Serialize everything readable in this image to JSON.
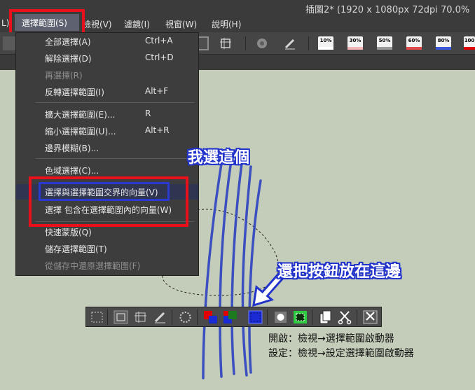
{
  "titlebar": {
    "title": "插圖2* (1920 x 1080px 72dpi 70.0%"
  },
  "menubar": {
    "items": [
      {
        "label": "L)"
      },
      {
        "label": "選擇範圍(S)"
      },
      {
        "label": "檢視(V)"
      },
      {
        "label": "濾鏡(I)"
      },
      {
        "label": "視窗(W)"
      },
      {
        "label": "說明(H)"
      }
    ]
  },
  "toolbar": {
    "percent_buttons": [
      {
        "label": "10%",
        "color": "#ffffff"
      },
      {
        "label": "30%",
        "color": "#f2b6b6"
      },
      {
        "label": "50%",
        "color": "#9a9a9a"
      },
      {
        "label": "60%",
        "color": "#e24b4b"
      },
      {
        "label": "80%",
        "color": "#3b57d9"
      },
      {
        "label": "100",
        "color": "#e00000"
      }
    ]
  },
  "menu": {
    "items": [
      {
        "label": "全部選擇(A)",
        "shortcut": "Ctrl+A"
      },
      {
        "label": "解除選擇(D)",
        "shortcut": "Ctrl+D"
      },
      {
        "label": "再選擇(R)",
        "shortcut": ""
      },
      {
        "label": "反轉選擇範圍(I)",
        "shortcut": "Alt+F"
      },
      {
        "label": "擴大選擇範圍(E)...",
        "shortcut": "R"
      },
      {
        "label": "縮小選擇範圍(U)...",
        "shortcut": "Alt+R"
      },
      {
        "label": "邊界模糊(B)...",
        "shortcut": ""
      },
      {
        "label": "色域選擇(C)...",
        "shortcut": ""
      },
      {
        "label": "選擇與選擇範圍交界的向量(V)",
        "shortcut": ""
      },
      {
        "label": "選擇 包含在選擇範圍內的向量(W)",
        "shortcut": ""
      },
      {
        "label": "快速蒙版(Q)",
        "shortcut": ""
      },
      {
        "label": "儲存選擇範圍(T)",
        "shortcut": ""
      },
      {
        "label": "從儲存中還原選擇範圍(F)",
        "shortcut": ""
      }
    ]
  },
  "callouts": {
    "choose": "我選這個",
    "button": "還把按鈕放在這邊"
  },
  "info": {
    "line1": "開啟：檢視→選擇範圍啟動器",
    "line2": "設定：檢視→設定選擇範圍啟動器"
  },
  "colors": {
    "highlight_red": "#e8101a",
    "highlight_blue": "#2a39d2",
    "stroke_blue": "#3c4fc0",
    "canvas": "#c4cdb9"
  },
  "launcher": {
    "icons": [
      "selection-rect-icon",
      "selection-rect-active-icon",
      "transform-icon",
      "pen-edit-icon",
      "spinner-icon",
      "vector-red-blue-icon",
      "vector-red-green-icon",
      "select-vector-icon",
      "record-icon",
      "fit-green-icon",
      "copy-icon",
      "scissors-icon",
      "cut-paste-icon"
    ]
  }
}
